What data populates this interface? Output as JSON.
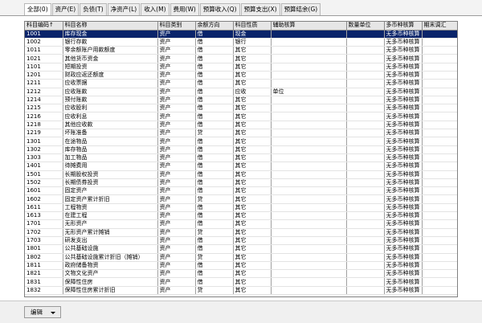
{
  "tabs": [
    "全部(0)",
    "资产(E)",
    "负债(T)",
    "净资产(L)",
    "收入(M)",
    "费用(W)",
    "预算收入(Q)",
    "预算支出(X)",
    "预算结余(G)"
  ],
  "columns": [
    "科目编码↑",
    "科目名称",
    "科目类别",
    "余额方向",
    "科目性质",
    "辅助核算",
    "数量单位",
    "多币种核算",
    "期末调汇",
    ""
  ],
  "rows": [
    [
      "1001",
      "库存现金",
      "资产",
      "借",
      "现金",
      "",
      "",
      "无多币种核算",
      "",
      ""
    ],
    [
      "1002",
      "银行存款",
      "资产",
      "借",
      "银行",
      "",
      "",
      "无多币种核算",
      "",
      ""
    ],
    [
      "1011",
      "零余额账户用款额度",
      "资产",
      "借",
      "其它",
      "",
      "",
      "无多币种核算",
      "",
      ""
    ],
    [
      "1021",
      "其他货币资金",
      "资产",
      "借",
      "其它",
      "",
      "",
      "无多币种核算",
      "",
      ""
    ],
    [
      "1101",
      "短期投资",
      "资产",
      "借",
      "其它",
      "",
      "",
      "无多币种核算",
      "",
      ""
    ],
    [
      "1201",
      "财政应返还额度",
      "资产",
      "借",
      "其它",
      "",
      "",
      "无多币种核算",
      "",
      ""
    ],
    [
      "1211",
      "应收票据",
      "资产",
      "借",
      "其它",
      "",
      "",
      "无多币种核算",
      "",
      ""
    ],
    [
      "1212",
      "应收账款",
      "资产",
      "借",
      "应收",
      "单位",
      "",
      "无多币种核算",
      "",
      ""
    ],
    [
      "1214",
      "预付账款",
      "资产",
      "借",
      "其它",
      "",
      "",
      "无多币种核算",
      "",
      ""
    ],
    [
      "1215",
      "应收股利",
      "资产",
      "借",
      "其它",
      "",
      "",
      "无多币种核算",
      "",
      ""
    ],
    [
      "1216",
      "应收利息",
      "资产",
      "借",
      "其它",
      "",
      "",
      "无多币种核算",
      "",
      ""
    ],
    [
      "1218",
      "其他应收款",
      "资产",
      "借",
      "其它",
      "",
      "",
      "无多币种核算",
      "",
      ""
    ],
    [
      "1219",
      "坏账准备",
      "资产",
      "贷",
      "其它",
      "",
      "",
      "无多币种核算",
      "",
      ""
    ],
    [
      "1301",
      "在途物品",
      "资产",
      "借",
      "其它",
      "",
      "",
      "无多币种核算",
      "",
      ""
    ],
    [
      "1302",
      "库存物品",
      "资产",
      "借",
      "其它",
      "",
      "",
      "无多币种核算",
      "",
      ""
    ],
    [
      "1303",
      "加工物品",
      "资产",
      "借",
      "其它",
      "",
      "",
      "无多币种核算",
      "",
      ""
    ],
    [
      "1401",
      "待摊费用",
      "资产",
      "借",
      "其它",
      "",
      "",
      "无多币种核算",
      "",
      ""
    ],
    [
      "1501",
      "长期股权投资",
      "资产",
      "借",
      "其它",
      "",
      "",
      "无多币种核算",
      "",
      ""
    ],
    [
      "1502",
      "长期债券投资",
      "资产",
      "借",
      "其它",
      "",
      "",
      "无多币种核算",
      "",
      ""
    ],
    [
      "1601",
      "固定资产",
      "资产",
      "借",
      "其它",
      "",
      "",
      "无多币种核算",
      "",
      ""
    ],
    [
      "1602",
      "固定资产累计折旧",
      "资产",
      "贷",
      "其它",
      "",
      "",
      "无多币种核算",
      "",
      ""
    ],
    [
      "1611",
      "工程物资",
      "资产",
      "借",
      "其它",
      "",
      "",
      "无多币种核算",
      "",
      ""
    ],
    [
      "1613",
      "在建工程",
      "资产",
      "借",
      "其它",
      "",
      "",
      "无多币种核算",
      "",
      ""
    ],
    [
      "1701",
      "无形资产",
      "资产",
      "借",
      "其它",
      "",
      "",
      "无多币种核算",
      "",
      ""
    ],
    [
      "1702",
      "无形资产累计摊销",
      "资产",
      "贷",
      "其它",
      "",
      "",
      "无多币种核算",
      "",
      ""
    ],
    [
      "1703",
      "研发支出",
      "资产",
      "借",
      "其它",
      "",
      "",
      "无多币种核算",
      "",
      ""
    ],
    [
      "1801",
      "公共基础设施",
      "资产",
      "借",
      "其它",
      "",
      "",
      "无多币种核算",
      "",
      ""
    ],
    [
      "1802",
      "公共基础设施累计折旧（摊销）",
      "资产",
      "贷",
      "其它",
      "",
      "",
      "无多币种核算",
      "",
      ""
    ],
    [
      "1811",
      "政府储备物资",
      "资产",
      "借",
      "其它",
      "",
      "",
      "无多币种核算",
      "",
      ""
    ],
    [
      "1821",
      "文物文化资产",
      "资产",
      "借",
      "其它",
      "",
      "",
      "无多币种核算",
      "",
      ""
    ],
    [
      "1831",
      "保障性住房",
      "资产",
      "借",
      "其它",
      "",
      "",
      "无多币种核算",
      "",
      ""
    ],
    [
      "1832",
      "保障性住房累计折旧",
      "资产",
      "贷",
      "其它",
      "",
      "",
      "无多币种核算",
      "",
      ""
    ]
  ],
  "footer": {
    "edit_label": "编辑"
  }
}
